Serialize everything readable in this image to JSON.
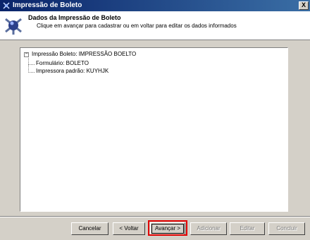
{
  "window": {
    "title": "Impressão de Boleto",
    "close_label": "X"
  },
  "header": {
    "title": "Dados da Impressão de Boleto",
    "subtitle": "Clique em avançar para cadastrar ou em voltar para editar os dados informados"
  },
  "tree": {
    "root": {
      "expander": "−",
      "label": "Impressão Boleto: IMPRESSÃO BOELTO"
    },
    "children": [
      {
        "label": "Formulário: BOLETO"
      },
      {
        "label": "Impressora padrão: KUYHJK"
      }
    ]
  },
  "buttons": {
    "cancel": "Cancelar",
    "back": "< Voltar",
    "next": "Avançar >",
    "add": "Adicionar",
    "edit": "Editar",
    "finish": "Concluir"
  },
  "colors": {
    "highlight": "#e00000",
    "titlebar": "#0a246a"
  }
}
